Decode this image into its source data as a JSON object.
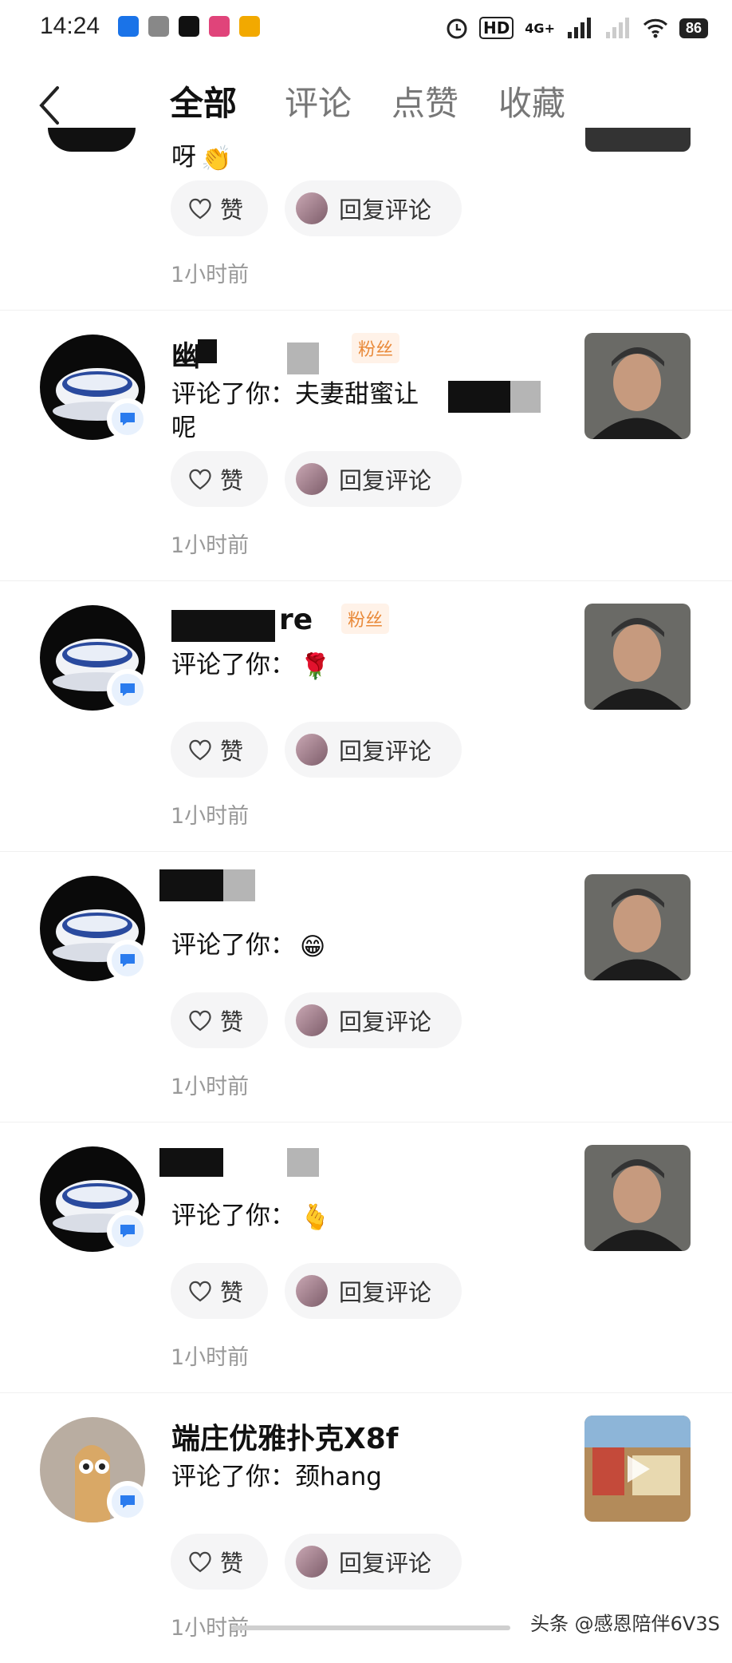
{
  "status_bar": {
    "time": "14:24",
    "battery": "86",
    "network": "4G+",
    "hd": "HD"
  },
  "nav": {
    "back_icon": "back-arrow-icon",
    "tabs": [
      {
        "label": "全部",
        "active": true
      },
      {
        "label": "评论",
        "active": false
      },
      {
        "label": "点赞",
        "active": false
      },
      {
        "label": "收藏",
        "active": false
      }
    ]
  },
  "common": {
    "like_label": "赞",
    "reply_label": "回复评论",
    "fan_label": "粉丝"
  },
  "items": [
    {
      "name": "",
      "comment": "呀",
      "emoji": "👏",
      "time": "1小时前"
    },
    {
      "name": "幽",
      "comment": "评论了你：夫妻甜蜜让",
      "comment_tail": "呢",
      "time": "1小时前"
    },
    {
      "name": "re",
      "comment": "评论了你：",
      "emoji": "🌹",
      "time": "1小时前"
    },
    {
      "name": "",
      "comment": "评论了你：",
      "emoji": "😁",
      "time": "1小时前"
    },
    {
      "name": "",
      "comment": "评论了你：",
      "emoji": "🫰",
      "time": "1小时前"
    },
    {
      "name": "端庄优雅扑克X8f",
      "comment": "评论了你：颈hang",
      "time": "1小时前"
    }
  ],
  "watermark": "头条 @感恩陪伴6V3S"
}
